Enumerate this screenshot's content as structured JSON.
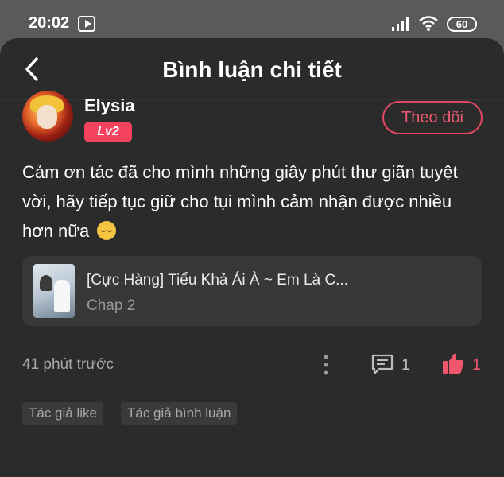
{
  "status_bar": {
    "time": "20:02",
    "battery": "60",
    "icons": [
      "app-icon",
      "signal-icon",
      "wifi-icon",
      "battery-icon"
    ]
  },
  "header": {
    "back_icon": "chevron-left-icon",
    "title": "Bình luận chi tiết"
  },
  "comment": {
    "username": "Elysia",
    "level": "Lv2",
    "follow_label": "Theo dõi",
    "text": "Cảm ơn tác đã cho mình những giây phút thư giãn tuyệt vời, hãy tiếp tục giữ cho tụi mình cảm nhận được nhiều hơn nữa",
    "emoji": "relieved-face-emoji",
    "time": "41 phút trước",
    "comment_count": "1",
    "like_count": "1"
  },
  "chapter_card": {
    "title": "[Cực Hàng] Tiểu Khả Ái À ~ Em Là C...",
    "subtitle": "Chap 2"
  },
  "tags": [
    "Tác giả like",
    "Tác giả bình luận"
  ],
  "colors": {
    "accent": "#f0566d",
    "panel_bg": "#2b2b2b",
    "card_bg": "#383838",
    "status_bg": "#5a5a5a"
  }
}
